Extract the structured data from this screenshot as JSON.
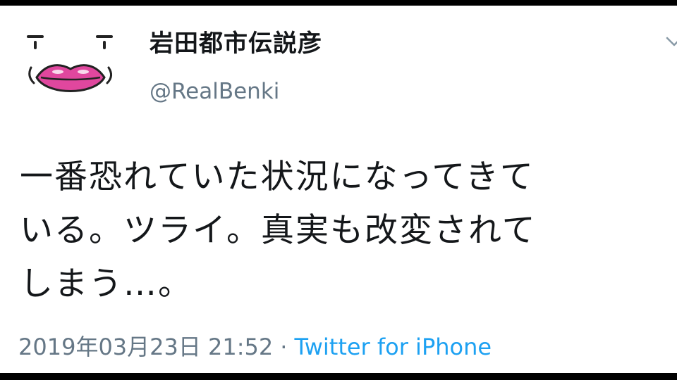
{
  "tweet": {
    "author": {
      "display_name": "岩田都市伝説彦",
      "handle": "@RealBenki",
      "avatar_icon": "lips-face-avatar-icon"
    },
    "menu_icon": "chevron-down-icon",
    "text_lines": [
      "一番恐れていた状況になってきて",
      "いる。ツライ。真実も改変されて",
      "しまう…。"
    ],
    "timestamp": "2019年03月23日 21:52",
    "separator": "·",
    "source": "Twitter for iPhone"
  },
  "colors": {
    "text": "#14171a",
    "muted": "#657786",
    "link": "#1da1f2",
    "lips": "#e0479e",
    "frame": "#000000"
  }
}
